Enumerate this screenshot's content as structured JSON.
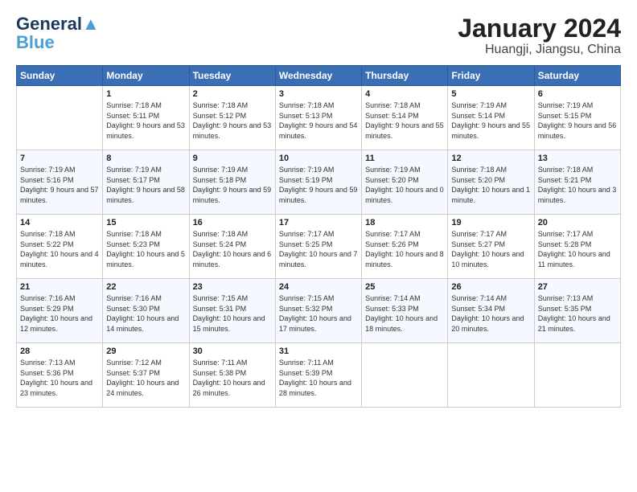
{
  "header": {
    "logo_line1": "General",
    "logo_line2": "Blue",
    "title": "January 2024",
    "subtitle": "Huangji, Jiangsu, China"
  },
  "columns": [
    "Sunday",
    "Monday",
    "Tuesday",
    "Wednesday",
    "Thursday",
    "Friday",
    "Saturday"
  ],
  "weeks": [
    [
      {
        "day": "",
        "sunrise": "",
        "sunset": "",
        "daylight": ""
      },
      {
        "day": "1",
        "sunrise": "Sunrise: 7:18 AM",
        "sunset": "Sunset: 5:11 PM",
        "daylight": "Daylight: 9 hours and 53 minutes."
      },
      {
        "day": "2",
        "sunrise": "Sunrise: 7:18 AM",
        "sunset": "Sunset: 5:12 PM",
        "daylight": "Daylight: 9 hours and 53 minutes."
      },
      {
        "day": "3",
        "sunrise": "Sunrise: 7:18 AM",
        "sunset": "Sunset: 5:13 PM",
        "daylight": "Daylight: 9 hours and 54 minutes."
      },
      {
        "day": "4",
        "sunrise": "Sunrise: 7:18 AM",
        "sunset": "Sunset: 5:14 PM",
        "daylight": "Daylight: 9 hours and 55 minutes."
      },
      {
        "day": "5",
        "sunrise": "Sunrise: 7:19 AM",
        "sunset": "Sunset: 5:14 PM",
        "daylight": "Daylight: 9 hours and 55 minutes."
      },
      {
        "day": "6",
        "sunrise": "Sunrise: 7:19 AM",
        "sunset": "Sunset: 5:15 PM",
        "daylight": "Daylight: 9 hours and 56 minutes."
      }
    ],
    [
      {
        "day": "7",
        "sunrise": "Sunrise: 7:19 AM",
        "sunset": "Sunset: 5:16 PM",
        "daylight": "Daylight: 9 hours and 57 minutes."
      },
      {
        "day": "8",
        "sunrise": "Sunrise: 7:19 AM",
        "sunset": "Sunset: 5:17 PM",
        "daylight": "Daylight: 9 hours and 58 minutes."
      },
      {
        "day": "9",
        "sunrise": "Sunrise: 7:19 AM",
        "sunset": "Sunset: 5:18 PM",
        "daylight": "Daylight: 9 hours and 59 minutes."
      },
      {
        "day": "10",
        "sunrise": "Sunrise: 7:19 AM",
        "sunset": "Sunset: 5:19 PM",
        "daylight": "Daylight: 9 hours and 59 minutes."
      },
      {
        "day": "11",
        "sunrise": "Sunrise: 7:19 AM",
        "sunset": "Sunset: 5:20 PM",
        "daylight": "Daylight: 10 hours and 0 minutes."
      },
      {
        "day": "12",
        "sunrise": "Sunrise: 7:18 AM",
        "sunset": "Sunset: 5:20 PM",
        "daylight": "Daylight: 10 hours and 1 minute."
      },
      {
        "day": "13",
        "sunrise": "Sunrise: 7:18 AM",
        "sunset": "Sunset: 5:21 PM",
        "daylight": "Daylight: 10 hours and 3 minutes."
      }
    ],
    [
      {
        "day": "14",
        "sunrise": "Sunrise: 7:18 AM",
        "sunset": "Sunset: 5:22 PM",
        "daylight": "Daylight: 10 hours and 4 minutes."
      },
      {
        "day": "15",
        "sunrise": "Sunrise: 7:18 AM",
        "sunset": "Sunset: 5:23 PM",
        "daylight": "Daylight: 10 hours and 5 minutes."
      },
      {
        "day": "16",
        "sunrise": "Sunrise: 7:18 AM",
        "sunset": "Sunset: 5:24 PM",
        "daylight": "Daylight: 10 hours and 6 minutes."
      },
      {
        "day": "17",
        "sunrise": "Sunrise: 7:17 AM",
        "sunset": "Sunset: 5:25 PM",
        "daylight": "Daylight: 10 hours and 7 minutes."
      },
      {
        "day": "18",
        "sunrise": "Sunrise: 7:17 AM",
        "sunset": "Sunset: 5:26 PM",
        "daylight": "Daylight: 10 hours and 8 minutes."
      },
      {
        "day": "19",
        "sunrise": "Sunrise: 7:17 AM",
        "sunset": "Sunset: 5:27 PM",
        "daylight": "Daylight: 10 hours and 10 minutes."
      },
      {
        "day": "20",
        "sunrise": "Sunrise: 7:17 AM",
        "sunset": "Sunset: 5:28 PM",
        "daylight": "Daylight: 10 hours and 11 minutes."
      }
    ],
    [
      {
        "day": "21",
        "sunrise": "Sunrise: 7:16 AM",
        "sunset": "Sunset: 5:29 PM",
        "daylight": "Daylight: 10 hours and 12 minutes."
      },
      {
        "day": "22",
        "sunrise": "Sunrise: 7:16 AM",
        "sunset": "Sunset: 5:30 PM",
        "daylight": "Daylight: 10 hours and 14 minutes."
      },
      {
        "day": "23",
        "sunrise": "Sunrise: 7:15 AM",
        "sunset": "Sunset: 5:31 PM",
        "daylight": "Daylight: 10 hours and 15 minutes."
      },
      {
        "day": "24",
        "sunrise": "Sunrise: 7:15 AM",
        "sunset": "Sunset: 5:32 PM",
        "daylight": "Daylight: 10 hours and 17 minutes."
      },
      {
        "day": "25",
        "sunrise": "Sunrise: 7:14 AM",
        "sunset": "Sunset: 5:33 PM",
        "daylight": "Daylight: 10 hours and 18 minutes."
      },
      {
        "day": "26",
        "sunrise": "Sunrise: 7:14 AM",
        "sunset": "Sunset: 5:34 PM",
        "daylight": "Daylight: 10 hours and 20 minutes."
      },
      {
        "day": "27",
        "sunrise": "Sunrise: 7:13 AM",
        "sunset": "Sunset: 5:35 PM",
        "daylight": "Daylight: 10 hours and 21 minutes."
      }
    ],
    [
      {
        "day": "28",
        "sunrise": "Sunrise: 7:13 AM",
        "sunset": "Sunset: 5:36 PM",
        "daylight": "Daylight: 10 hours and 23 minutes."
      },
      {
        "day": "29",
        "sunrise": "Sunrise: 7:12 AM",
        "sunset": "Sunset: 5:37 PM",
        "daylight": "Daylight: 10 hours and 24 minutes."
      },
      {
        "day": "30",
        "sunrise": "Sunrise: 7:11 AM",
        "sunset": "Sunset: 5:38 PM",
        "daylight": "Daylight: 10 hours and 26 minutes."
      },
      {
        "day": "31",
        "sunrise": "Sunrise: 7:11 AM",
        "sunset": "Sunset: 5:39 PM",
        "daylight": "Daylight: 10 hours and 28 minutes."
      },
      {
        "day": "",
        "sunrise": "",
        "sunset": "",
        "daylight": ""
      },
      {
        "day": "",
        "sunrise": "",
        "sunset": "",
        "daylight": ""
      },
      {
        "day": "",
        "sunrise": "",
        "sunset": "",
        "daylight": ""
      }
    ]
  ]
}
